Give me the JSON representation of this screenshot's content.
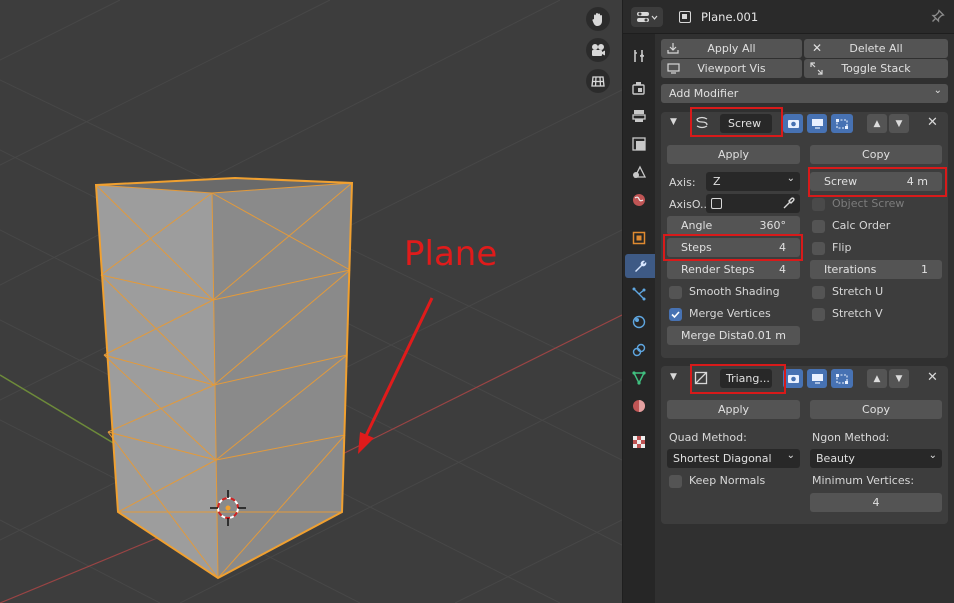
{
  "annotation": {
    "label": "Plane"
  },
  "header": {
    "object_name": "Plane.001"
  },
  "toolbar": {
    "apply_all": "Apply All",
    "delete_all": "Delete All",
    "viewport_vis": "Viewport Vis",
    "toggle_stack": "Toggle Stack",
    "add_modifier": "Add Modifier"
  },
  "screw": {
    "name": "Screw",
    "apply": "Apply",
    "copy": "Copy",
    "axis_label": "Axis:",
    "axis_value": "Z",
    "axis_object_label": "AxisO...",
    "angle_label": "Angle",
    "angle_value": "360°",
    "steps_label": "Steps",
    "steps_value": "4",
    "render_steps_label": "Render Steps",
    "render_steps_value": "4",
    "smooth_shading": "Smooth Shading",
    "merge_vertices": "Merge Vertices",
    "merge_distance_label": "Merge Dista",
    "merge_distance_value": "0.01 m",
    "screw_label": "Screw",
    "screw_value": "4 m",
    "object_screw": "Object Screw",
    "calc_order": "Calc Order",
    "flip": "Flip",
    "iterations_label": "Iterations",
    "iterations_value": "1",
    "stretch_u": "Stretch U",
    "stretch_v": "Stretch V"
  },
  "triangulate": {
    "name": "Triang...",
    "apply": "Apply",
    "copy": "Copy",
    "quad_method_label": "Quad Method:",
    "quad_method_value": "Shortest Diagonal",
    "ngon_method_label": "Ngon Method:",
    "ngon_method_value": "Beauty",
    "keep_normals": "Keep Normals",
    "min_vertices_label": "Minimum Vertices:",
    "min_vertices_value": "4"
  },
  "colors": {
    "accent": "#4772b3",
    "annotation": "#e01b1b",
    "selection_outline": "#f0a030"
  }
}
